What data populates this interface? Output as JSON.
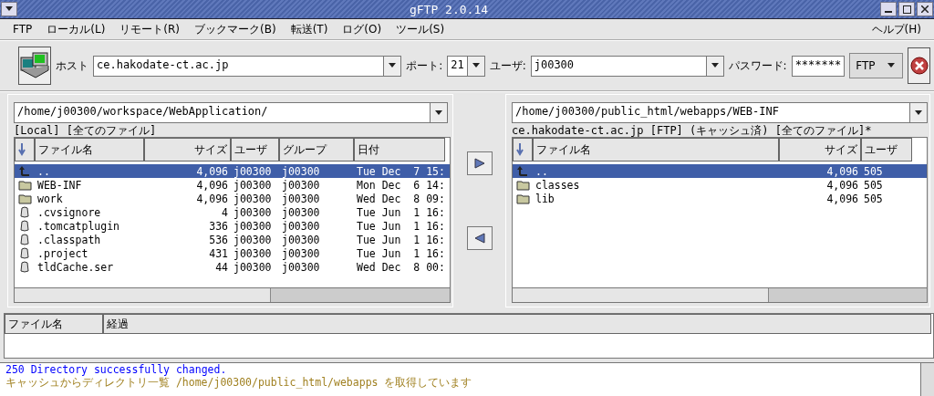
{
  "window": {
    "title": "gFTP 2.0.14"
  },
  "menu": [
    {
      "label": "FTP"
    },
    {
      "label": "ローカル(L)"
    },
    {
      "label": "リモート(R)"
    },
    {
      "label": "ブックマーク(B)"
    },
    {
      "label": "転送(T)"
    },
    {
      "label": "ログ(O)"
    },
    {
      "label": "ツール(S)"
    },
    {
      "label": "ヘルプ(H)"
    }
  ],
  "toolbar": {
    "host_label": "ホスト",
    "host": "ce.hakodate-ct.ac.jp",
    "port_label": "ポート:",
    "port": "21",
    "user_label": "ユーザ:",
    "user": "j00300",
    "password_label": "パスワード:",
    "password": "*******",
    "protocol": "FTP"
  },
  "panels": [
    {
      "path": "/home/j00300/workspace/WebApplication/",
      "status": "[Local] [全てのファイル]",
      "columns": [
        "ファイル名",
        "サイズ",
        "ユーザ",
        "グループ",
        "日付"
      ],
      "rows": [
        {
          "kind": "up",
          "selected": true,
          "cells": [
            "..",
            "4,096",
            "j00300",
            "j00300",
            "Tue Dec  7 15:"
          ]
        },
        {
          "kind": "folder",
          "selected": false,
          "cells": [
            "WEB-INF",
            "4,096",
            "j00300",
            "j00300",
            "Mon Dec  6 14:"
          ]
        },
        {
          "kind": "folder",
          "selected": false,
          "cells": [
            "work",
            "4,096",
            "j00300",
            "j00300",
            "Wed Dec  8 09:"
          ]
        },
        {
          "kind": "file",
          "selected": false,
          "cells": [
            ".cvsignore",
            "4",
            "j00300",
            "j00300",
            "Tue Jun  1 16:"
          ]
        },
        {
          "kind": "file",
          "selected": false,
          "cells": [
            ".tomcatplugin",
            "336",
            "j00300",
            "j00300",
            "Tue Jun  1 16:"
          ]
        },
        {
          "kind": "file",
          "selected": false,
          "cells": [
            ".classpath",
            "536",
            "j00300",
            "j00300",
            "Tue Jun  1 16:"
          ]
        },
        {
          "kind": "file",
          "selected": false,
          "cells": [
            ".project",
            "431",
            "j00300",
            "j00300",
            "Tue Jun  1 16:"
          ]
        },
        {
          "kind": "file",
          "selected": false,
          "cells": [
            "tldCache.ser",
            "44",
            "j00300",
            "j00300",
            "Wed Dec  8 00:"
          ]
        }
      ]
    },
    {
      "path": "/home/j00300/public_html/webapps/WEB-INF",
      "status": "ce.hakodate-ct.ac.jp [FTP] (キャッシュ済) [全てのファイル]*",
      "columns": [
        "ファイル名",
        "サイズ",
        "ユーザ"
      ],
      "rows": [
        {
          "kind": "up",
          "selected": true,
          "cells": [
            "..",
            "4,096",
            "505"
          ]
        },
        {
          "kind": "folder",
          "selected": false,
          "cells": [
            "classes",
            "4,096",
            "505"
          ]
        },
        {
          "kind": "folder",
          "selected": false,
          "cells": [
            "lib",
            "4,096",
            "505"
          ]
        }
      ]
    }
  ],
  "transfers": {
    "columns": [
      "ファイル名",
      "経過"
    ]
  },
  "log": [
    {
      "text": "250 Directory successfully changed.",
      "color": "#0000ff"
    },
    {
      "text": "キャッシュからディレクトリ一覧 /home/j00300/public_html/webapps を取得しています",
      "color": "#a08020"
    }
  ]
}
